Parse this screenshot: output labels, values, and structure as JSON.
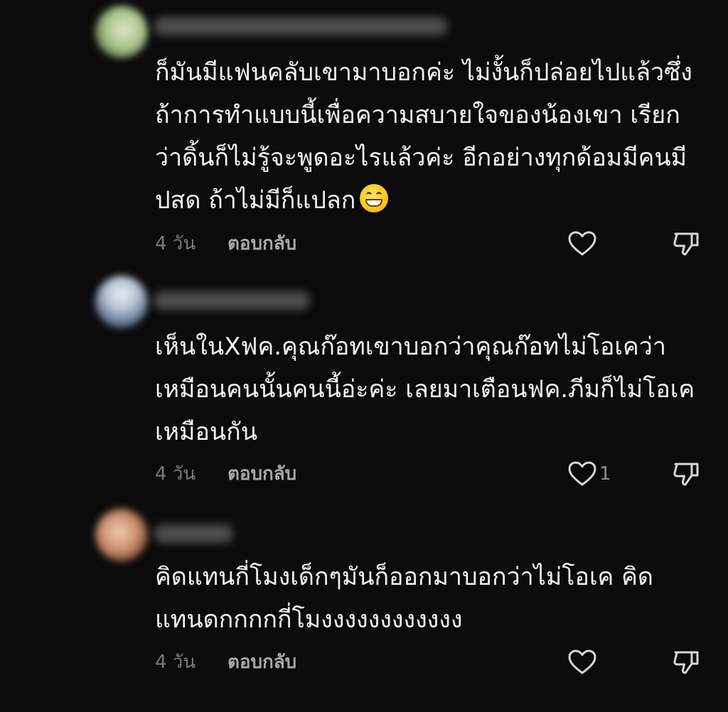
{
  "comments": [
    {
      "username": "",
      "text": "ก็มันมีแฟนคลับเขามาบอกค่ะ ไม่งั้นก็ปล่อยไปแล้วซึ่ง\nถ้าการทำแบบนี้เพื่อความสบายใจของน้องเขา เรียก\nว่าดิ้นก็ไม่รู้จะพูดอะไรแล้วค่ะ อีกอย่างทุกด้อมมีคนมี\nปสด ถ้าไม่มีก็แปลก",
      "emoji": "grinning-face",
      "time": "4 วัน",
      "reply_label": "ตอบกลับ",
      "likes": ""
    },
    {
      "username": "",
      "text": "เห็นในXฟค.คุณก๊อทเขาบอกว่าคุณก๊อทไม่โอเคว่า\nเหมือนคนนั้นคนนี้อ่ะค่ะ เลยมาเตือนฟค.ภีมก็ไม่โอเค\nเหมือนกัน",
      "time": "4 วัน",
      "reply_label": "ตอบกลับ",
      "likes": "1"
    },
    {
      "username": "",
      "text": "คิดแทนกี่โมงเด็กๆมันก็ออกมาบอกว่าไม่โอเค คิด\nแทนดกกกกกี่โมงงงงงงงงงงงง",
      "time": "4 วัน",
      "reply_label": "ตอบกลับ",
      "likes": ""
    }
  ],
  "colors": {
    "background": "#0b0b0c",
    "text": "#f2f2f2",
    "muted": "#7b7b7b",
    "reply": "#a8a8a8",
    "icon": "#d6d6d6"
  },
  "icons": {
    "like": "heart-outline-icon",
    "dislike": "thumbs-down-icon"
  }
}
